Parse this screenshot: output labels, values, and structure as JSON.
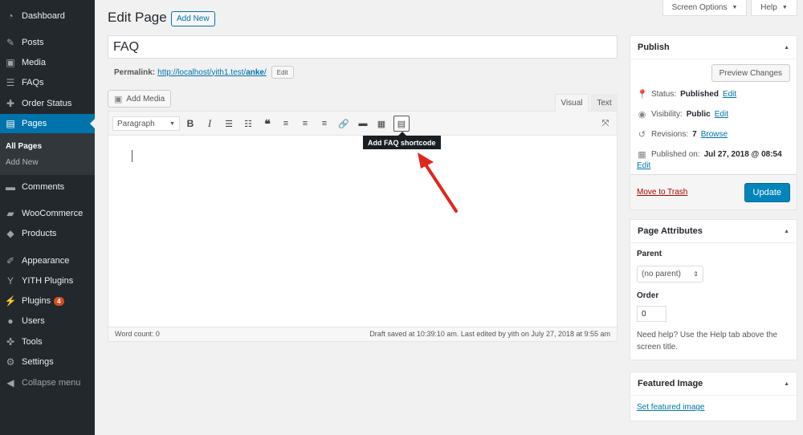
{
  "sidebar": {
    "items": [
      {
        "label": "Dashboard",
        "icon": "dashboard-icon",
        "glyph": "◔"
      },
      {
        "label": "Posts",
        "icon": "pin-icon",
        "glyph": "✎"
      },
      {
        "label": "Media",
        "icon": "media-icon",
        "glyph": "▣"
      },
      {
        "label": "FAQs",
        "icon": "list-icon",
        "glyph": "☰"
      },
      {
        "label": "Order Status",
        "icon": "wrench-icon",
        "glyph": "✚"
      },
      {
        "label": "Pages",
        "icon": "pages-icon",
        "glyph": "▤"
      },
      {
        "label": "Comments",
        "icon": "comment-icon",
        "glyph": "▬"
      },
      {
        "label": "WooCommerce",
        "icon": "woocommerce-icon",
        "glyph": "▰"
      },
      {
        "label": "Products",
        "icon": "box-icon",
        "glyph": "◆"
      },
      {
        "label": "Appearance",
        "icon": "brush-icon",
        "glyph": "✐"
      },
      {
        "label": "YITH Plugins",
        "icon": "yith-icon",
        "glyph": "Y"
      },
      {
        "label": "Plugins",
        "icon": "plugin-icon",
        "glyph": "⚡"
      },
      {
        "label": "Users",
        "icon": "users-icon",
        "glyph": "●"
      },
      {
        "label": "Tools",
        "icon": "tools-icon",
        "glyph": "✜"
      },
      {
        "label": "Settings",
        "icon": "settings-icon",
        "glyph": "⚙"
      },
      {
        "label": "Collapse menu",
        "icon": "collapse-icon",
        "glyph": "◀"
      }
    ],
    "submenu": [
      "All Pages",
      "Add New"
    ],
    "plugins_badge": "4"
  },
  "topbar": {
    "screen_options": "Screen Options",
    "help": "Help"
  },
  "header": {
    "title": "Edit Page",
    "add_new": "Add New"
  },
  "post": {
    "title": "FAQ",
    "permalink_label": "Permalink:",
    "permalink_base": "http://localhost/yith1.test/",
    "permalink_slug": "anke",
    "permalink_end": "/",
    "edit_label": "Edit"
  },
  "editor": {
    "add_media": "Add Media",
    "tab_visual": "Visual",
    "tab_text": "Text",
    "format": "Paragraph",
    "tooltip": "Add FAQ shortcode",
    "word_count": "Word count: 0",
    "draft_status": "Draft saved at 10:39:10 am. Last edited by yith on July 27, 2018 at 9:55 am"
  },
  "publish": {
    "title": "Publish",
    "preview": "Preview Changes",
    "status_label": "Status:",
    "status_value": "Published",
    "visibility_label": "Visibility:",
    "visibility_value": "Public",
    "revisions_label": "Revisions:",
    "revisions_value": "7",
    "browse": "Browse",
    "published_label": "Published on:",
    "published_value": "Jul 27, 2018 @ 08:54",
    "edit": "Edit",
    "trash": "Move to Trash",
    "update": "Update"
  },
  "attributes": {
    "title": "Page Attributes",
    "parent_label": "Parent",
    "parent_value": "(no parent)",
    "order_label": "Order",
    "order_value": "0",
    "help_text": "Need help? Use the Help tab above the screen title."
  },
  "featured": {
    "title": "Featured Image",
    "link": "Set featured image"
  },
  "colors": {
    "sidebar": "#23282d",
    "accent": "#0073aa",
    "annotation_arrow": "#e0271e"
  }
}
